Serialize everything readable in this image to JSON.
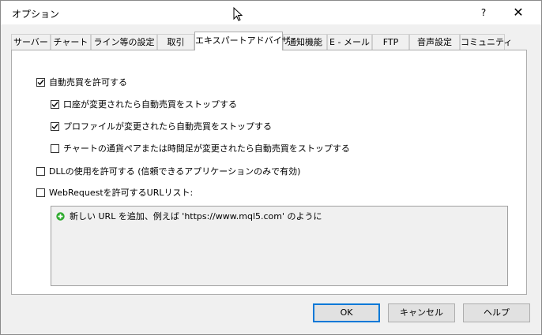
{
  "window": {
    "title": "オプション",
    "help_label": "?",
    "close_label": "✕"
  },
  "tabs": [
    {
      "label": "サーバー",
      "active": false
    },
    {
      "label": "チャート",
      "active": false
    },
    {
      "label": "ライン等の設定",
      "active": false
    },
    {
      "label": "取引",
      "active": false
    },
    {
      "label": "エキスパートアドバイザ",
      "active": true
    },
    {
      "label": "通知機能",
      "active": false
    },
    {
      "label": "E - メール",
      "active": false
    },
    {
      "label": "FTP",
      "active": false
    },
    {
      "label": "音声設定",
      "active": false
    },
    {
      "label": "コミュニティ",
      "active": false
    }
  ],
  "options": {
    "auto_trading": {
      "label": "自動売買を許可する",
      "checked": true
    },
    "stop_on_account_change": {
      "label": "口座が変更されたら自動売買をストップする",
      "checked": true
    },
    "stop_on_profile_change": {
      "label": "プロファイルが変更されたら自動売買をストップする",
      "checked": true
    },
    "stop_on_symbol_change": {
      "label": "チャートの通貨ペアまたは時間足が変更されたら自動売買をストップする",
      "checked": false
    },
    "allow_dll": {
      "label": "DLLの使用を許可する (信頼できるアプリケーションのみで有効)",
      "checked": false
    },
    "allow_webrequest": {
      "label": "WebRequestを許可するURLリスト:",
      "checked": false
    }
  },
  "url_list": {
    "add_hint": "新しい URL を追加、例えば 'https://www.mql5.com' のように",
    "add_icon": "plus-circle-icon",
    "add_icon_color": "#2eaa2e"
  },
  "buttons": {
    "ok": "OK",
    "cancel": "キャンセル",
    "help": "ヘルプ"
  },
  "colors": {
    "accent": "#0078d7",
    "dialog_bg": "#f0f0f0",
    "panel_bg": "#ffffff"
  }
}
